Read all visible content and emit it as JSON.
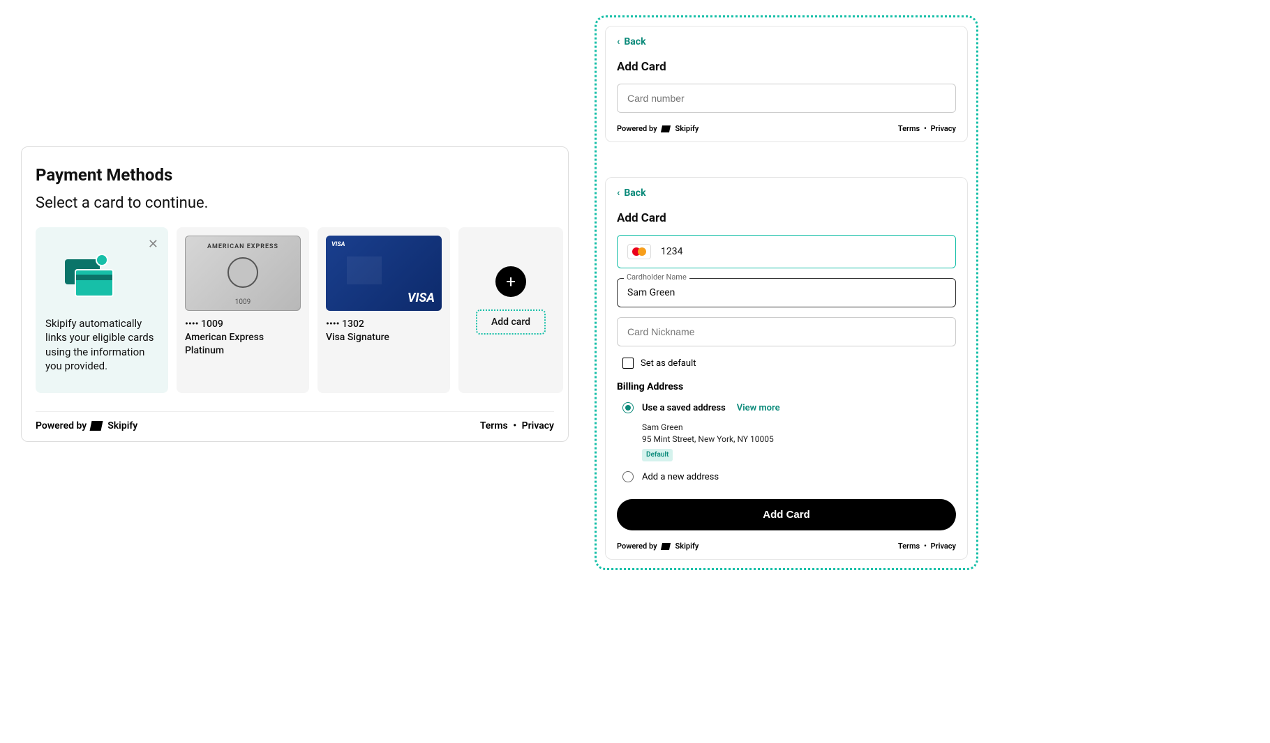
{
  "paymentMethods": {
    "title": "Payment Methods",
    "subtitle": "Select a card to continue.",
    "infoText": "Skipify automatically links your eligible cards using the information you provided.",
    "cards": [
      {
        "masked": "•••• 1009",
        "name": "American Express Platinum",
        "brand": "AMERICAN EXPRESS",
        "lastDigits": "1009"
      },
      {
        "masked": "•••• 1302",
        "name": "Visa Signature",
        "brand": "VISA",
        "logoTop": "VISA"
      }
    ],
    "addCardLabel": "Add card"
  },
  "footer": {
    "poweredBy": "Powered by",
    "brand": "Skipify",
    "terms": "Terms",
    "privacy": "Privacy"
  },
  "addCard1": {
    "back": "Back",
    "title": "Add Card",
    "cardNumberPlaceholder": "Card number"
  },
  "addCard2": {
    "back": "Back",
    "title": "Add Card",
    "cardNumberValue": "1234",
    "cardholderLabel": "Cardholder Name",
    "cardholderValue": "Sam Green",
    "nicknamePlaceholder": "Card Nickname",
    "setDefault": "Set as default",
    "billingTitle": "Billing Address",
    "useSaved": "Use a saved address",
    "viewMore": "View more",
    "savedName": "Sam Green",
    "savedAddress": "95 Mint Street, New York, NY 10005",
    "defaultBadge": "Default",
    "addNewAddress": "Add a new address",
    "submitLabel": "Add Card"
  }
}
